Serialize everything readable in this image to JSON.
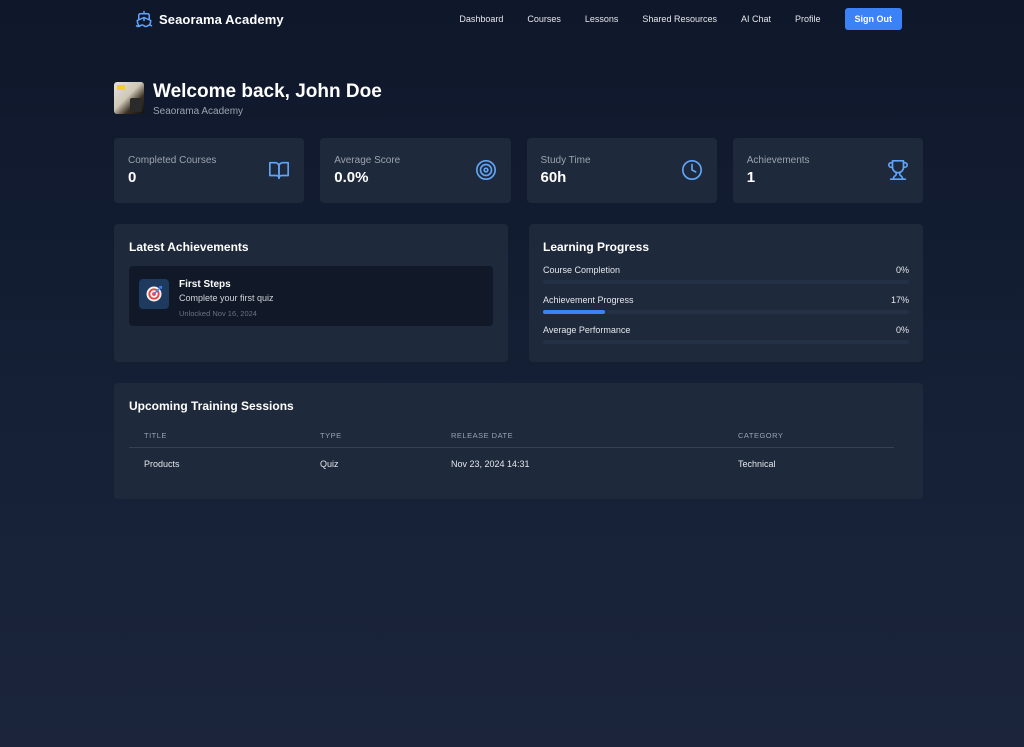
{
  "nav": {
    "brand": "Seaorama Academy",
    "links": [
      "Dashboard",
      "Courses",
      "Lessons",
      "Shared Resources",
      "AI Chat",
      "Profile"
    ],
    "signout": "Sign Out"
  },
  "header": {
    "title": "Welcome back, John Doe",
    "subtitle": "Seaorama Academy"
  },
  "stats": [
    {
      "label": "Completed Courses",
      "value": "0",
      "icon": "book-icon"
    },
    {
      "label": "Average Score",
      "value": "0.0%",
      "icon": "target-icon"
    },
    {
      "label": "Study Time",
      "value": "60h",
      "icon": "clock-icon"
    },
    {
      "label": "Achievements",
      "value": "1",
      "icon": "trophy-icon"
    }
  ],
  "achievements": {
    "title": "Latest Achievements",
    "items": [
      {
        "name": "First Steps",
        "desc": "Complete your first quiz",
        "date": "Unlocked Nov 16, 2024",
        "icon": "dart-target-icon"
      }
    ]
  },
  "progress": {
    "title": "Learning Progress",
    "rows": [
      {
        "label": "Course Completion",
        "value": "0%",
        "percent": 0
      },
      {
        "label": "Achievement Progress",
        "value": "17%",
        "percent": 17
      },
      {
        "label": "Average Performance",
        "value": "0%",
        "percent": 0
      }
    ]
  },
  "sessions": {
    "title": "Upcoming Training Sessions",
    "columns": [
      "TITLE",
      "TYPE",
      "RELEASE DATE",
      "CATEGORY"
    ],
    "rows": [
      [
        "Products",
        "Quiz",
        "Nov 23, 2024 14:31",
        "Technical"
      ]
    ]
  },
  "colors": {
    "accent": "#3b82f6",
    "icon": "#60a5fa",
    "card": "#1e293b",
    "background": "#0f172a"
  }
}
